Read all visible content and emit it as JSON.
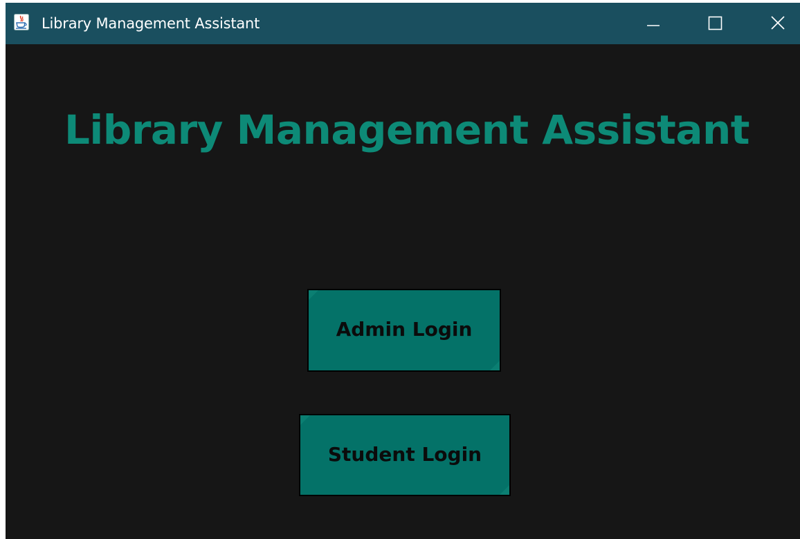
{
  "window": {
    "title": "Library Management Assistant",
    "icon": "java-cup-icon",
    "controls": [
      "minimize-icon",
      "maximize-icon",
      "close-icon"
    ]
  },
  "main": {
    "heading": "Library Management Assistant",
    "admin_login_label": "Admin Login",
    "student_login_label": "Student Login"
  },
  "colors": {
    "titlebar": "#1a4f5f",
    "background": "#161616",
    "accent_text": "#0d8a77",
    "button_fill": "#047268",
    "button_text": "#0b0b0b"
  }
}
